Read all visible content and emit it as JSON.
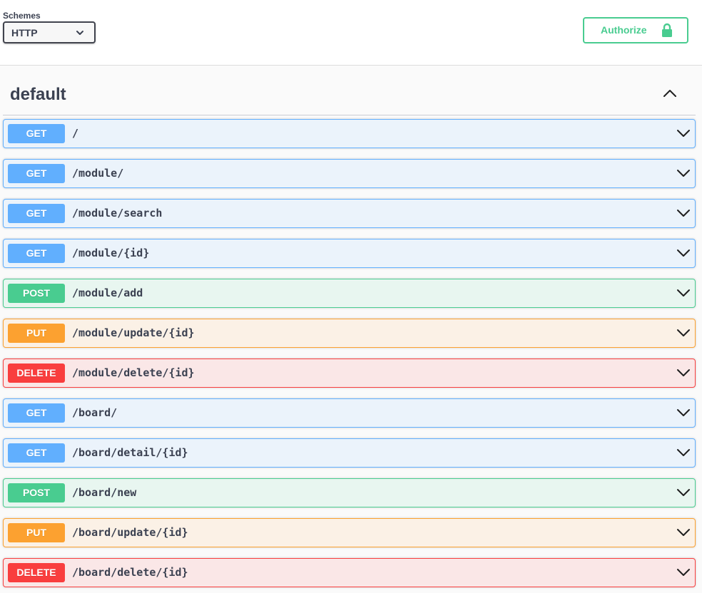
{
  "schemes": {
    "label": "Schemes",
    "selected": "HTTP"
  },
  "authorize": {
    "label": "Authorize"
  },
  "tag": {
    "name": "default"
  },
  "operations": [
    {
      "method": "GET",
      "path": "/"
    },
    {
      "method": "GET",
      "path": "/module/"
    },
    {
      "method": "GET",
      "path": "/module/search"
    },
    {
      "method": "GET",
      "path": "/module/{id}"
    },
    {
      "method": "POST",
      "path": "/module/add"
    },
    {
      "method": "PUT",
      "path": "/module/update/{id}"
    },
    {
      "method": "DELETE",
      "path": "/module/delete/{id}"
    },
    {
      "method": "GET",
      "path": "/board/"
    },
    {
      "method": "GET",
      "path": "/board/detail/{id}"
    },
    {
      "method": "POST",
      "path": "/board/new"
    },
    {
      "method": "PUT",
      "path": "/board/update/{id}"
    },
    {
      "method": "DELETE",
      "path": "/board/delete/{id}"
    }
  ],
  "colors": {
    "get": "#61affe",
    "post": "#49cc90",
    "put": "#fca130",
    "delete": "#f93e3e",
    "authorize": "#49cc90"
  },
  "icons": {
    "schemes_caret": "chevron-down-icon",
    "authorize": "lock-icon",
    "tag_toggle": "chevron-up-icon",
    "operation_toggle": "chevron-down-icon"
  }
}
